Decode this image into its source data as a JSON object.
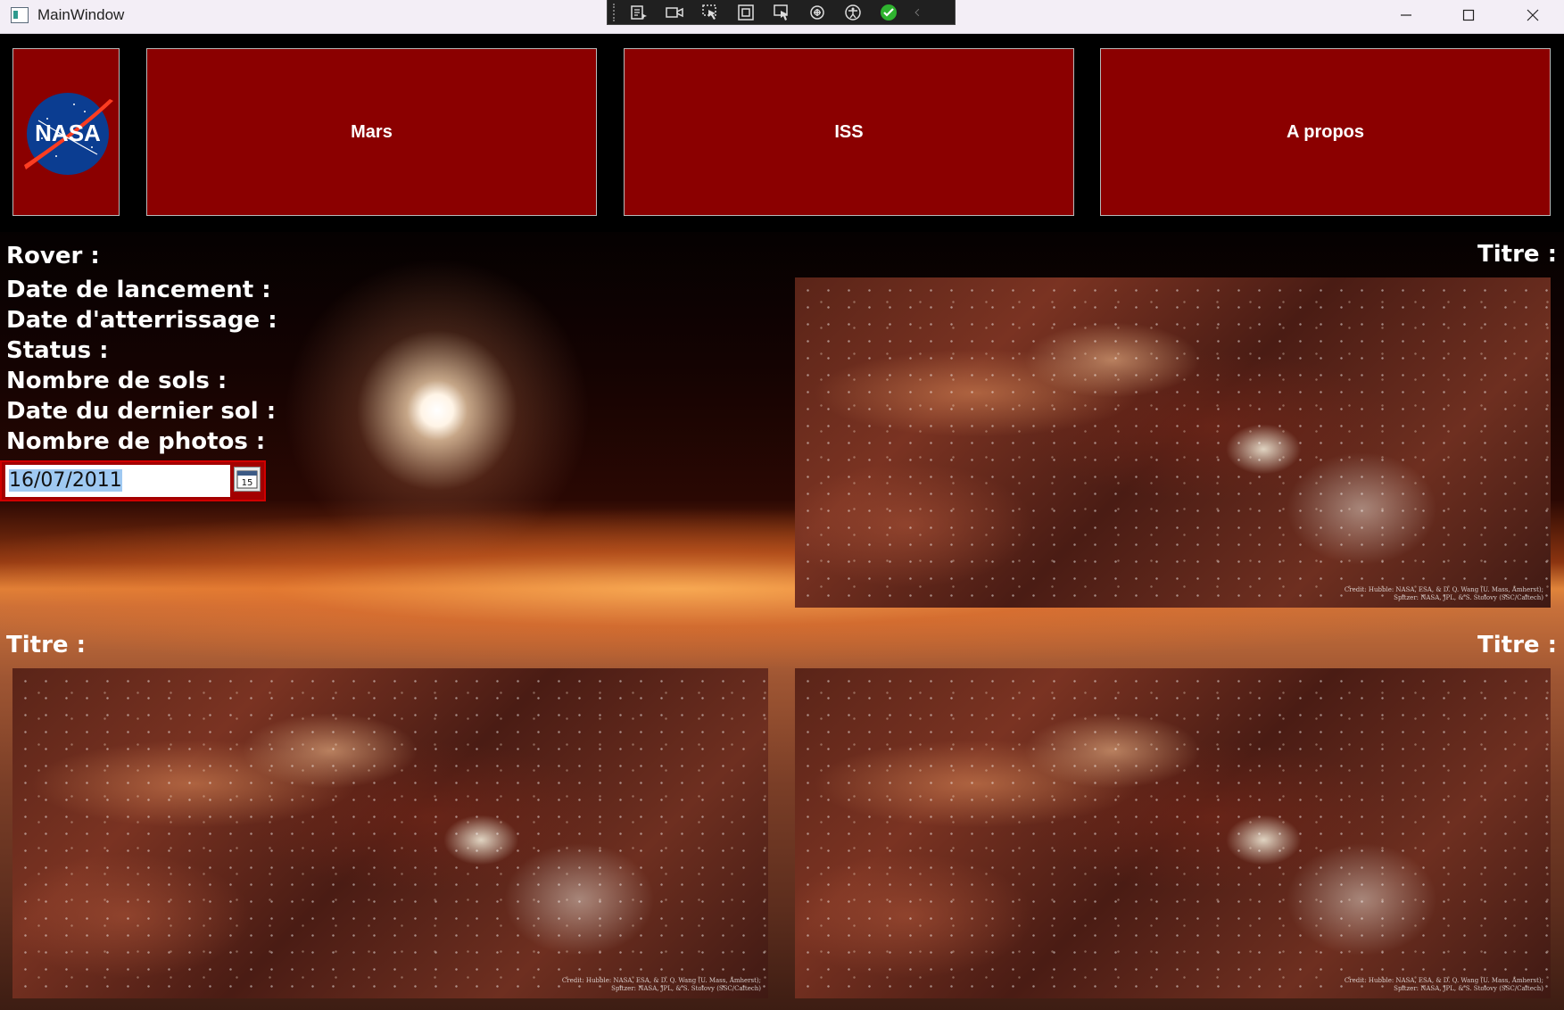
{
  "window": {
    "title": "MainWindow",
    "controls": [
      "minimize-icon",
      "maximize-icon",
      "close-icon"
    ]
  },
  "debug_toolbar": {
    "icons": [
      "live-visual-tree-icon",
      "record-icon",
      "select-element-icon",
      "display-layout-adorners-icon",
      "track-focus-icon",
      "binding-failures-icon",
      "accessibility-icon",
      "checkmark-icon",
      "collapse-chevron-icon"
    ]
  },
  "nav": {
    "logo_text": "NASA",
    "mars": "Mars",
    "iss": "ISS",
    "about": "A propos"
  },
  "info": {
    "rover": "Rover :",
    "launch_date": "Date de lancement :",
    "landing_date": "Date d'atterrissage :",
    "status": "Status :",
    "sol_count": "Nombre de sols :",
    "last_sol_date": "Date du dernier sol :",
    "photo_count": "Nombre de photos :"
  },
  "date_picker": {
    "value": "16/07/2011",
    "calendar_day": "15"
  },
  "photos": [
    {
      "title_label": "Titre :",
      "credit_line1": "Credit: Hubble: NASA, ESA, & D. Q. Wang (U. Mass, Amherst);",
      "credit_line2": "Spitzer: NASA, JPL, & S. Stolovy (SSC/Caltech)"
    },
    {
      "title_label": "Titre :",
      "credit_line1": "Credit: Hubble: NASA, ESA, & D. Q. Wang (U. Mass, Amherst);",
      "credit_line2": "Spitzer: NASA, JPL, & S. Stolovy (SSC/Caltech)"
    },
    {
      "title_label": "Titre :",
      "credit_line1": "Credit: Hubble: NASA, ESA, & D. Q. Wang (U. Mass, Amherst);",
      "credit_line2": "Spitzer: NASA, JPL, & S. Stolovy (SSC/Caltech)"
    }
  ],
  "colors": {
    "nav_tile": "#8b0000",
    "date_picker_border": "#d00000",
    "selection": "#9fc9f2"
  }
}
